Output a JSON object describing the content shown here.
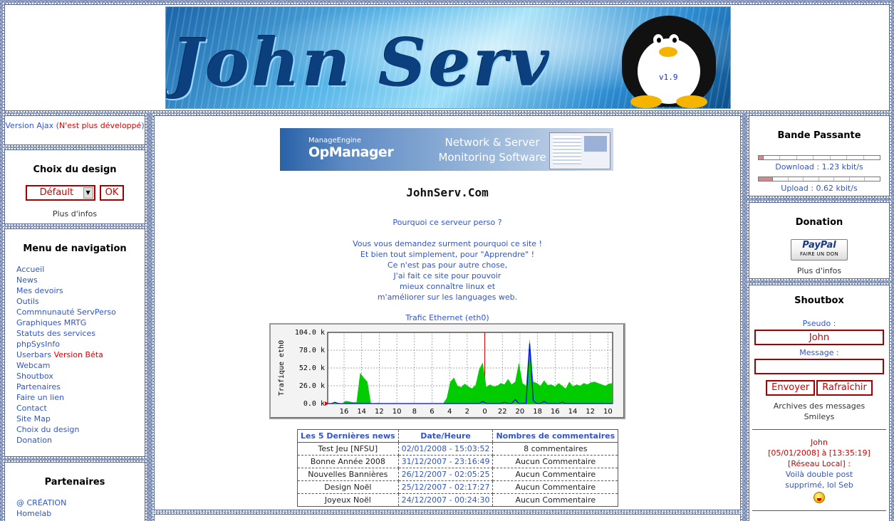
{
  "header": {
    "banner_title": "John Serv",
    "version": "v1.9"
  },
  "left": {
    "ajax": {
      "prefix": "Version Ajax (",
      "note": "N'est plus développé",
      "suffix": ")"
    },
    "design": {
      "title": "Choix du design",
      "selected": "Défault",
      "ok_label": "OK",
      "info_link": "Plus d'infos"
    },
    "nav": {
      "title": "Menu de navigation",
      "items": [
        {
          "label": "Accueil"
        },
        {
          "label": "News"
        },
        {
          "label": "Mes devoirs"
        },
        {
          "label": "Outils"
        },
        {
          "label": "Commnunauté ServPerso"
        },
        {
          "label": "Graphiques MRTG"
        },
        {
          "label": "Statuts des services"
        },
        {
          "label": "phpSysInfo"
        },
        {
          "label": "Userbars",
          "badge": "Version Béta"
        },
        {
          "label": "Webcam"
        },
        {
          "label": "Shoutbox"
        },
        {
          "label": "Partenaires"
        },
        {
          "label": "Faire un lien"
        },
        {
          "label": "Contact"
        },
        {
          "label": "Site Map"
        },
        {
          "label": "Choix du design"
        },
        {
          "label": "Donation"
        }
      ]
    },
    "partners": {
      "title": "Partenaires",
      "items": [
        "@ CRÉATION",
        "Homelab"
      ]
    }
  },
  "main": {
    "ad": {
      "brand_small": "ManageEngine",
      "brand_big": "OpManager",
      "tagline_1": "Network & Server",
      "tagline_2": "Monitoring Software"
    },
    "site_title": "JohnServ.Com",
    "intro_heading": "Pourquoi ce serveur perso ?",
    "intro_lines": [
      "Vous vous demandez surment pourquoi ce site !",
      "Et bien tout simplement, pour \"Apprendre\" !",
      "Ce n'est pas pour autre chose,",
      "J'ai fait ce site pour pouvoir",
      "mieux connaître linux et",
      "m'améliorer sur les languages web."
    ],
    "traffic_caption": "Trafic Ethernet (eth0)",
    "news_table": {
      "headers": [
        "Les 5 Dernières news",
        "Date/Heure",
        "Nombres de commentaires"
      ],
      "rows": [
        {
          "title": "Test Jeu [NFSU]",
          "date": "02/01/2008 - 15:03:52",
          "comments": "8 commentaires"
        },
        {
          "title": "Bonne Année 2008",
          "date": "31/12/2007 - 23:16:49",
          "comments": "Aucun Commentaire"
        },
        {
          "title": "Nouvelles Bannières",
          "date": "26/12/2007 - 02:05:25",
          "comments": "Aucun Commentaire"
        },
        {
          "title": "Design Noël",
          "date": "25/12/2007 - 02:17:27",
          "comments": "Aucun Commentaire"
        },
        {
          "title": "Joyeux Noël",
          "date": "24/12/2007 - 00:24:30",
          "comments": "Aucun Commentaire"
        }
      ]
    }
  },
  "chart_data": {
    "type": "area",
    "title": "",
    "ylabel": "Trafique eth0",
    "xlabel": "",
    "y_ticks": [
      "0.0 k",
      "26.0 k",
      "52.0 k",
      "78.0 k",
      "104.0 k"
    ],
    "ylim": [
      0,
      104
    ],
    "x_tick_labels": [
      "16",
      "14",
      "12",
      "10",
      "8",
      "6",
      "4",
      "2",
      "0",
      "22",
      "20",
      "18",
      "16",
      "14",
      "12",
      "10"
    ],
    "grid": true,
    "series": [
      {
        "color": "#00cc00",
        "kind": "area",
        "values": [
          0,
          0,
          2,
          1,
          0,
          4,
          3,
          2,
          2,
          45,
          38,
          32,
          0,
          0,
          1,
          0,
          0,
          0,
          0,
          0,
          0,
          0,
          0,
          0,
          0,
          0,
          0,
          0,
          0,
          0,
          0,
          0,
          0,
          8,
          32,
          38,
          26,
          24,
          29,
          25,
          22,
          27,
          50,
          60,
          24,
          28,
          25,
          26,
          30,
          28,
          36,
          28,
          32,
          60,
          30,
          26,
          95,
          32,
          30,
          26,
          34,
          27,
          28,
          25,
          30,
          26,
          22,
          32,
          25,
          28,
          26,
          30,
          28,
          31,
          32,
          30,
          28,
          26,
          29,
          30
        ]
      },
      {
        "color": "#0000ff",
        "kind": "line",
        "values": [
          0,
          0,
          2,
          0,
          0,
          0,
          0,
          0,
          0,
          0,
          0,
          0,
          0,
          0,
          0,
          0,
          0,
          0,
          0,
          0,
          0,
          0,
          0,
          0,
          0,
          0,
          0,
          0,
          0,
          0,
          0,
          0,
          0,
          0,
          0,
          0,
          0,
          0,
          0,
          0,
          0,
          0,
          0,
          3,
          0,
          0,
          0,
          0,
          0,
          2,
          0,
          0,
          6,
          0,
          0,
          0,
          88,
          4,
          0,
          0,
          3,
          0,
          0,
          0,
          0,
          2,
          0,
          0,
          0,
          0,
          0,
          0,
          0,
          0,
          0,
          0,
          0,
          0,
          0,
          0
        ]
      }
    ]
  },
  "right": {
    "bandwidth": {
      "title": "Bande Passante",
      "download_fraction": 0.04,
      "upload_fraction": 0.12,
      "download_label": "Download : 1.23 kbit/s",
      "upload_label": "Upload : 0.62 kbit/s"
    },
    "donation": {
      "title": "Donation",
      "paypal_logo": "PayPal",
      "paypal_sub": "FAIRE UN DON",
      "info_link": "Plus d'infos"
    },
    "shoutbox": {
      "title": "Shoutbox",
      "pseudo_label": "Pseudo :",
      "pseudo_value": "John",
      "message_label": "Message :",
      "message_value": "",
      "send_label": "Envoyer",
      "refresh_label": "Rafraîchir",
      "archives_link": "Archives des messages",
      "smileys_link": "Smileys",
      "last_message": {
        "author": "John",
        "date": "[05/01/2008] à [13:35:19]",
        "origin": "[Réseau Local] :",
        "text_1": "Voilà double post",
        "text_2": "supprimé, lol Seb"
      }
    }
  },
  "colors": {
    "link": "#3055c8",
    "accent_red": "#d00000",
    "graph_in": "#00cc00",
    "graph_out": "#0000ff"
  }
}
